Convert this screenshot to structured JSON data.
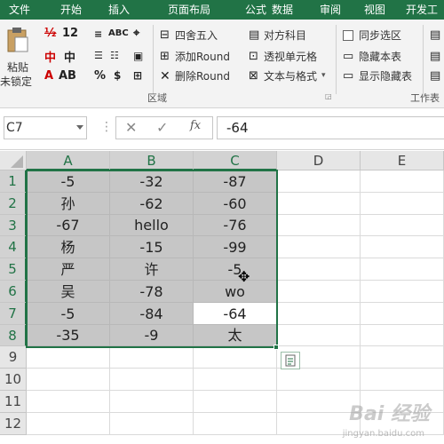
{
  "tabs": [
    "文件",
    "开始",
    "插入",
    "页面布局",
    "公式",
    "数据",
    "审阅",
    "视图",
    "开发工"
  ],
  "ribbon": {
    "paste_label": "粘贴",
    "unlock_label": "未锁定",
    "font_size": "12",
    "font_btn_a": "中",
    "font_btn_ab": "AB",
    "font_btn_abc": "ABC",
    "percent": "%",
    "comma": "$",
    "round_btn": "四舍五入",
    "add_round_btn": "添加Round",
    "del_round_btn": "删除Round",
    "align_btn": "对方科目",
    "perspective_btn": "透视单元格",
    "text_format_btn": "文本与格式",
    "group_label_area": "区域",
    "sync_select": "同步选区",
    "hide_sheet": "隐藏本表",
    "show_hidden": "显示隐藏表",
    "group_label_sheet": "工作表"
  },
  "formula_bar": {
    "name_box": "C7",
    "fx": "fx",
    "value": "-64"
  },
  "columns": [
    "A",
    "B",
    "C",
    "D",
    "E"
  ],
  "rows": [
    "1",
    "2",
    "3",
    "4",
    "5",
    "6",
    "7",
    "8",
    "9",
    "10",
    "11",
    "12"
  ],
  "cells": [
    [
      "-5",
      "-32",
      "-87"
    ],
    [
      "孙",
      "-62",
      "-60"
    ],
    [
      "-67",
      "hello",
      "-76"
    ],
    [
      "杨",
      "-15",
      "-99"
    ],
    [
      "严",
      "许",
      "-5"
    ],
    [
      "吴",
      "-78",
      "wo"
    ],
    [
      "-5",
      "-84",
      "-64"
    ],
    [
      "-35",
      "-9",
      "太"
    ]
  ],
  "watermark": "Bai 经验",
  "watermark_sub": "jingyan.baidu.com",
  "colors": {
    "accent": "#217346",
    "selection_fill": "#c6c6c6"
  }
}
